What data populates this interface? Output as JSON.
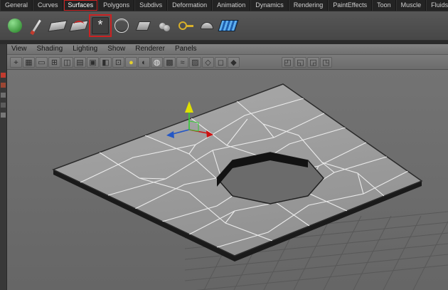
{
  "shelf_tabs": {
    "items": [
      {
        "label": "General"
      },
      {
        "label": "Curves"
      },
      {
        "label": "Surfaces",
        "selected": true
      },
      {
        "label": "Polygons"
      },
      {
        "label": "Subdivs"
      },
      {
        "label": "Deformation"
      },
      {
        "label": "Animation"
      },
      {
        "label": "Dynamics"
      },
      {
        "label": "Rendering"
      },
      {
        "label": "PaintEffects"
      },
      {
        "label": "Toon"
      },
      {
        "label": "Muscle"
      },
      {
        "label": "Fluids"
      }
    ],
    "annotation_color": "#cc2222"
  },
  "shelf": {
    "icons": [
      {
        "name": "nurbs-sphere-icon"
      },
      {
        "name": "pencil-curve-icon"
      },
      {
        "name": "plane-icon"
      },
      {
        "name": "plane-curve-icon"
      },
      {
        "name": "create-polygon-icon",
        "glyph": "*",
        "annotated": true
      },
      {
        "name": "wire-sphere-icon"
      },
      {
        "name": "cube-icon"
      },
      {
        "name": "two-spheres-icon"
      },
      {
        "name": "key-icon"
      },
      {
        "name": "half-sphere-icon"
      },
      {
        "name": "loft-icon"
      }
    ],
    "annotation_color": "#cc2222"
  },
  "panel_menu": {
    "items": [
      {
        "label": "View"
      },
      {
        "label": "Shading"
      },
      {
        "label": "Lighting"
      },
      {
        "label": "Show"
      },
      {
        "label": "Renderer"
      },
      {
        "label": "Panels"
      }
    ]
  },
  "panel_toolbar": {
    "icons": [
      {
        "name": "select-camera-icon",
        "glyph": "⌖"
      },
      {
        "name": "grid-icon",
        "glyph": "▦"
      },
      {
        "name": "film-gate-icon",
        "glyph": "▭"
      },
      {
        "name": "resolution-gate-icon",
        "glyph": "⊞"
      },
      {
        "name": "gate-mask-icon",
        "glyph": "◫"
      },
      {
        "name": "field-chart-icon",
        "glyph": "▤"
      },
      {
        "name": "safe-action-icon",
        "glyph": "▣"
      },
      {
        "name": "safe-title-icon",
        "glyph": "◧"
      },
      {
        "name": "frame-all-icon",
        "glyph": "⊡"
      },
      {
        "name": "lighting-icon",
        "glyph": "●"
      },
      {
        "name": "shadows-icon",
        "glyph": "◐"
      },
      {
        "name": "textures-icon",
        "glyph": "◍"
      },
      {
        "name": "occlusion-icon",
        "glyph": "▩"
      },
      {
        "name": "motion-blur-icon",
        "glyph": "≈"
      },
      {
        "name": "xray-icon",
        "glyph": "▨"
      },
      {
        "name": "wireframe-on-shaded-icon",
        "glyph": "◇"
      },
      {
        "name": "isolate-select-icon",
        "glyph": "◻"
      },
      {
        "name": "camera-settings-icon",
        "glyph": "◆"
      },
      {
        "name": "default-material-icon",
        "glyph": "◰"
      },
      {
        "name": "textured-view-icon",
        "glyph": "◱"
      },
      {
        "name": "layout-single-icon",
        "glyph": "◲"
      },
      {
        "name": "layout-quad-icon",
        "glyph": "◳"
      }
    ]
  },
  "toolbox": {
    "icons": [
      {
        "name": "select-tool-icon"
      },
      {
        "name": "lasso-tool-icon"
      },
      {
        "name": "paint-select-tool-icon"
      },
      {
        "name": "move-tool-icon"
      },
      {
        "name": "rotate-tool-icon"
      }
    ]
  },
  "viewport": {
    "content": "polygon plane with voronoi faces and octagonal hole",
    "background": "#6d6d6d",
    "mesh_fill": "#9e9e9e",
    "edge_color": "#ebebeb",
    "manipulator": {
      "tool": "move",
      "axis_colors": {
        "x": "#cc1111",
        "y": "#33cc33",
        "y_cone": "#e0e000",
        "z": "#2457c5"
      }
    },
    "grid_color": "#585858"
  }
}
